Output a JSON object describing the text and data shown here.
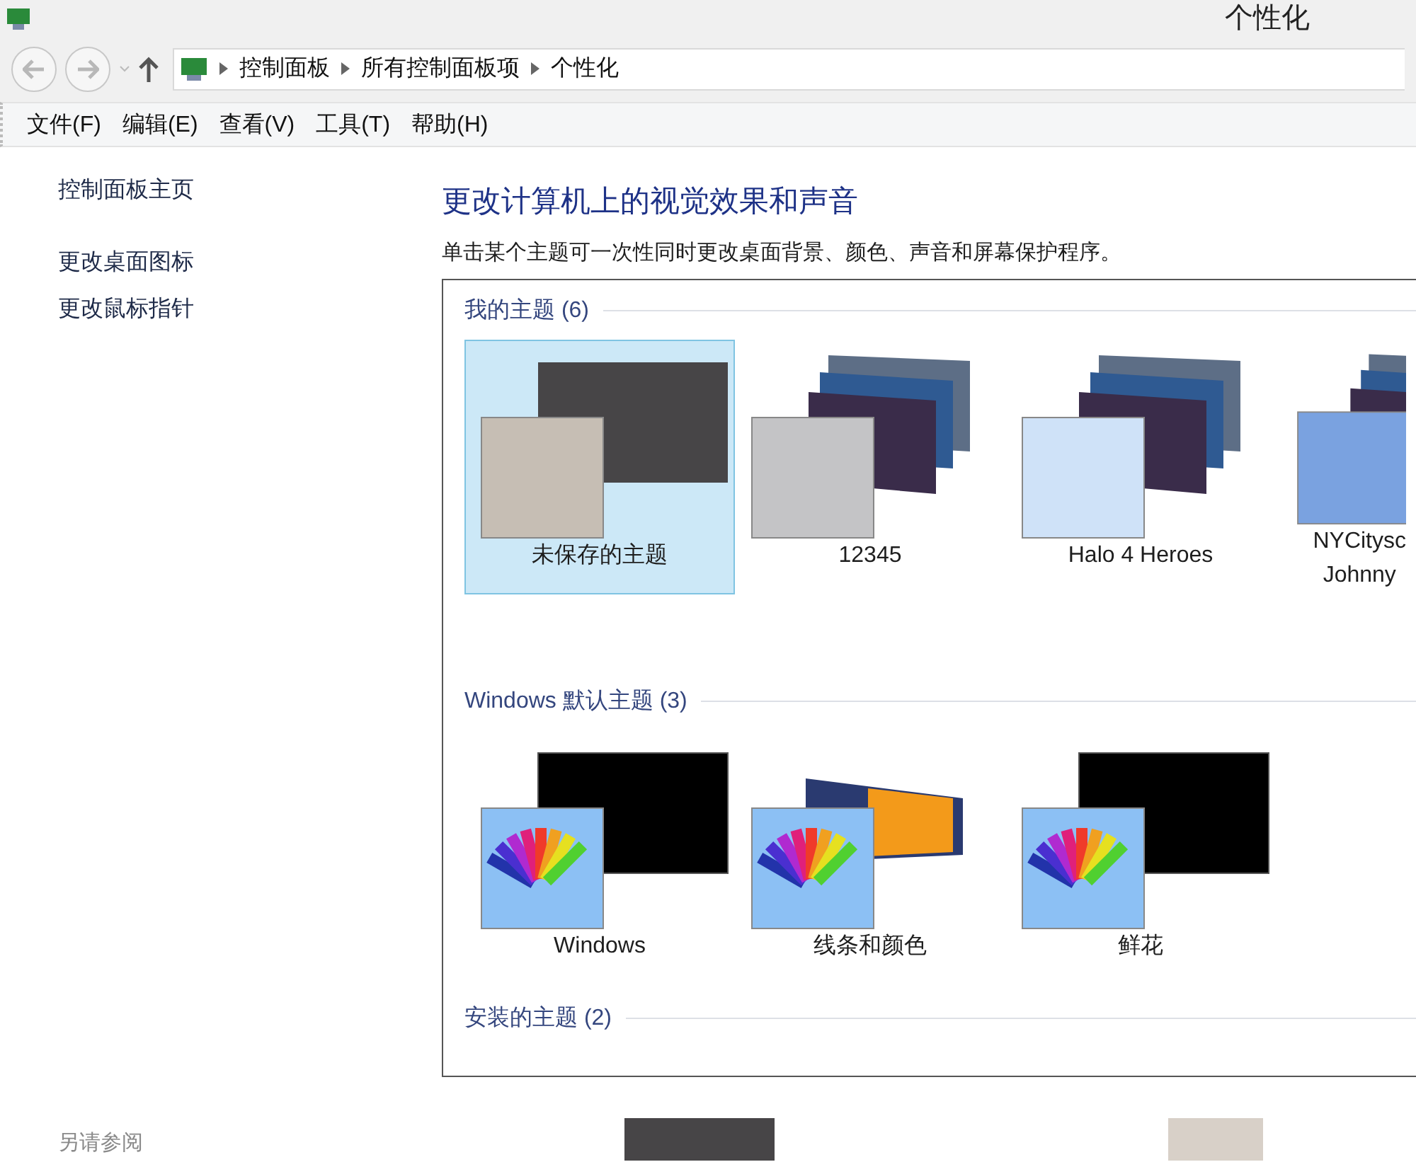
{
  "window": {
    "title": "个性化"
  },
  "address": {
    "segments": [
      "控制面板",
      "所有控制面板项",
      "个性化"
    ]
  },
  "menu": [
    "文件(F)",
    "编辑(E)",
    "查看(V)",
    "工具(T)",
    "帮助(H)"
  ],
  "sidebar": {
    "links": [
      {
        "label": "控制面板主页"
      },
      {
        "label": "更改桌面图标"
      },
      {
        "label": "更改鼠标指针"
      }
    ],
    "see_also": "另请参阅"
  },
  "main": {
    "heading": "更改计算机上的视觉效果和声音",
    "description": "单击某个主题可一次性同时更改桌面背景、颜色、声音和屏幕保护程序。",
    "groups": [
      {
        "title": "我的主题",
        "count": "(6)",
        "themes": [
          {
            "name": [
              "未保存的主题"
            ],
            "kind": "solid",
            "color": "#c6beb4",
            "selected": true
          },
          {
            "name": [
              "12345"
            ],
            "kind": "slideshow",
            "color": "#c4c4c6",
            "selected": false
          },
          {
            "name": [
              "Halo 4 Heroes"
            ],
            "kind": "slideshow",
            "color": "#cfe2f8",
            "selected": false
          },
          {
            "name": [
              "NYCitysc",
              "Johnny"
            ],
            "kind": "slideshow",
            "color": "#7aa2e0",
            "selected": false
          }
        ]
      },
      {
        "title": "Windows 默认主题",
        "count": "(3)",
        "themes": [
          {
            "name": [
              "Windows"
            ],
            "kind": "palette",
            "selected": false
          },
          {
            "name": [
              "线条和颜色"
            ],
            "kind": "palette-stripes",
            "selected": false
          },
          {
            "name": [
              "鲜花"
            ],
            "kind": "palette",
            "selected": false
          }
        ]
      },
      {
        "title": "安装的主题",
        "count": "(2)"
      }
    ]
  }
}
